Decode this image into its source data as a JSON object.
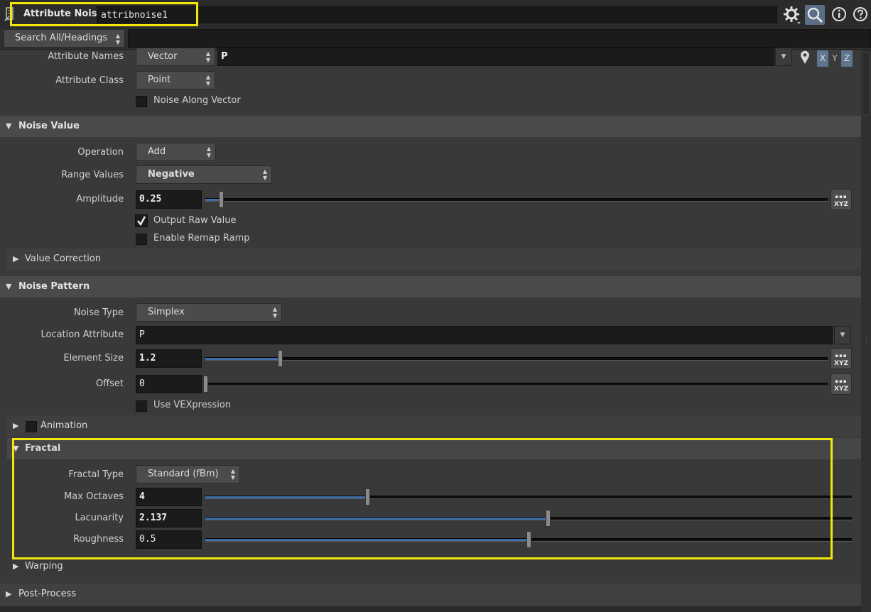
{
  "header": {
    "node_type": "Attribute Noise",
    "node_name": "attribnoise1"
  },
  "search": {
    "mode": "Search All/Headings"
  },
  "params": {
    "attribute_names": {
      "label": "Attribute Names",
      "type_value": "Vector",
      "value": "P",
      "x": "X",
      "y": "Y",
      "z": "Z"
    },
    "attribute_class": {
      "label": "Attribute Class",
      "value": "Point"
    },
    "noise_along_vector": {
      "label": "Noise Along Vector",
      "checked": false
    }
  },
  "noise_value": {
    "title": "Noise Value",
    "operation": {
      "label": "Operation",
      "value": "Add"
    },
    "range_values": {
      "label": "Range Values",
      "value": "Negative"
    },
    "amplitude": {
      "label": "Amplitude",
      "value": "0.25",
      "slider_fraction": 0.025
    },
    "output_raw_value": {
      "label": "Output Raw Value",
      "checked": true
    },
    "enable_remap_ramp": {
      "label": "Enable Remap Ramp",
      "checked": false
    },
    "value_correction": {
      "title": "Value Correction"
    }
  },
  "noise_pattern": {
    "title": "Noise Pattern",
    "noise_type": {
      "label": "Noise Type",
      "value": "Simplex"
    },
    "location_attribute": {
      "label": "Location Attribute",
      "value": "P"
    },
    "element_size": {
      "label": "Element Size",
      "value": "1.2",
      "slider_fraction": 0.12
    },
    "offset": {
      "label": "Offset",
      "value": "0",
      "slider_fraction": 0.0
    },
    "use_vexpression": {
      "label": "Use VEXpression",
      "checked": false
    },
    "animation": {
      "title": "Animation"
    }
  },
  "fractal": {
    "title": "Fractal",
    "fractal_type": {
      "label": "Fractal Type",
      "value": "Standard (fBm)"
    },
    "max_octaves": {
      "label": "Max Octaves",
      "value": "4",
      "slider_fraction": 0.25
    },
    "lacunarity": {
      "label": "Lacunarity",
      "value": "2.137",
      "slider_fraction": 0.53
    },
    "roughness": {
      "label": "Roughness",
      "value": "0.5",
      "slider_fraction": 0.5
    }
  },
  "warping": {
    "title": "Warping"
  },
  "post_process": {
    "title": "Post-Process"
  },
  "xyz_button_label": "XYZ",
  "colors": {
    "highlight": "#f2e60a",
    "accent_blue": "#3f6da5",
    "panel_bg": "#393939"
  }
}
